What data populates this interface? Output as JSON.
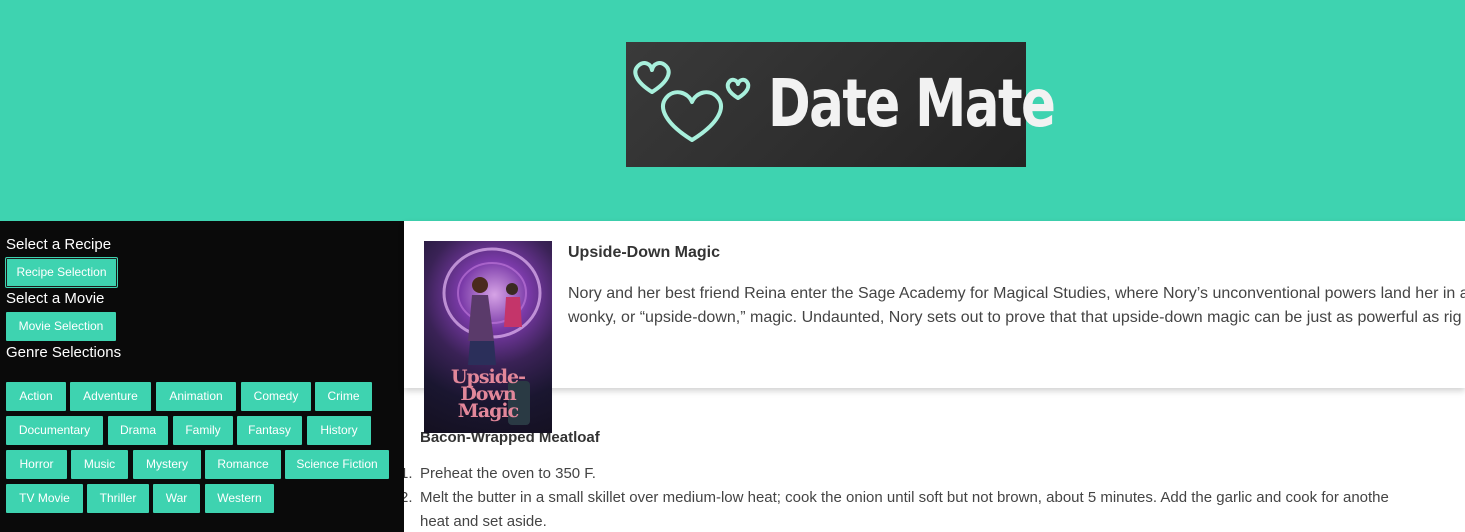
{
  "header": {
    "logo_text": "Date Mate"
  },
  "sidebar": {
    "recipe_label": "Select a Recipe",
    "recipe_button": "Recipe Selection",
    "movie_label": "Select a Movie",
    "movie_button": "Movie Selection",
    "genre_label": "Genre Selections",
    "genres": [
      "Action",
      "Adventure",
      "Animation",
      "Comedy",
      "Crime",
      "Documentary",
      "Drama",
      "Family",
      "Fantasy",
      "History",
      "Horror",
      "Music",
      "Mystery",
      "Romance",
      "Science Fiction",
      "TV Movie",
      "Thriller",
      "War",
      "Western"
    ]
  },
  "movie": {
    "poster_title": "Upside-Down Magic",
    "title": "Upside-Down Magic",
    "description_line1": "Nory and her best friend Reina enter the Sage Academy for Magical Studies, where Nory’s unconventional powers land her in a",
    "description_line2": "wonky, or “upside-down,” magic. Undaunted, Nory sets out to prove that that upside-down magic can be just as powerful as rig"
  },
  "recipe": {
    "title": "Bacon-Wrapped Meatloaf",
    "steps": [
      {
        "num": "1.",
        "text": "Preheat the oven to 350 F."
      },
      {
        "num": "2.",
        "text": "Melt the butter in a small skillet over medium-low heat; cook the onion until soft but not brown, about 5 minutes. Add the garlic and cook for anothe"
      },
      {
        "num": "",
        "text": "heat and set aside."
      }
    ]
  },
  "colors": {
    "accent": "#3ed3b0",
    "sidebar_bg": "#0a0a0a",
    "logo_bg": "#2b2b2b",
    "heart_outline": "#a8f0dc"
  }
}
